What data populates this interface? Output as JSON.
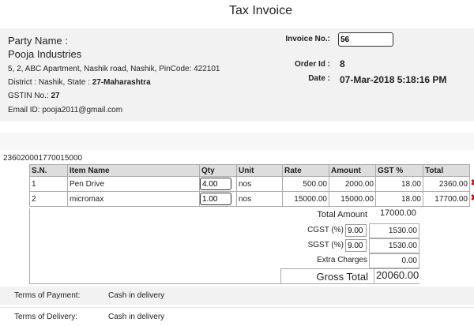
{
  "page": {
    "title": "Tax Invoice"
  },
  "party": {
    "label": "Party Name :",
    "name": "Pooja Industries",
    "address": "5, 2, ABC Apartment, Nashik road, Nashik, PinCode: 422101",
    "district_prefix": "District : Nashik, State : ",
    "state": "27-Maharashtra",
    "gstin_label": "GSTIN No.: ",
    "gstin": "27",
    "email": "Email ID: pooja2011@gmail.com"
  },
  "invoice": {
    "number_label": "Invoice No.:",
    "number": "56",
    "order_label": "Order Id :",
    "order_id": "8",
    "date_label": "Date :",
    "date": "07-Mar-2018 5:18:16 PM"
  },
  "code": "236020001770015000",
  "table": {
    "headers": [
      "S.N.",
      "Item Name",
      "Qty",
      "Unit",
      "Rate",
      "Amount",
      "GST %",
      "Total"
    ],
    "rows": [
      {
        "sn": "1",
        "name": "Pen Drive",
        "qty": "4.00",
        "unit": "nos",
        "rate": "500.00",
        "amount": "2000.00",
        "gst": "18.00",
        "total": "2360.00"
      },
      {
        "sn": "2",
        "name": "micromax",
        "qty": "1.00",
        "unit": "nos",
        "rate": "15000.00",
        "amount": "15000.00",
        "gst": "18.00",
        "total": "17700.00"
      }
    ]
  },
  "totals": {
    "total_amount_label": "Total Amount",
    "total_amount": "17000.00",
    "cgst_label": "CGST (%)",
    "cgst_pct": "9.00",
    "cgst": "1530.00",
    "sgst_label": "SGST (%)",
    "sgst_pct": "9.00",
    "sgst": "1530.00",
    "extra_label": "Extra Charges",
    "extra": "0.00",
    "gross_label": "Gross Total",
    "gross": "20060.00"
  },
  "terms": {
    "payment_label": "Terms of Payment:",
    "payment": "Cash in delivery",
    "delivery_label": "Terms of Delivery:",
    "delivery": "Cash in delivery"
  }
}
